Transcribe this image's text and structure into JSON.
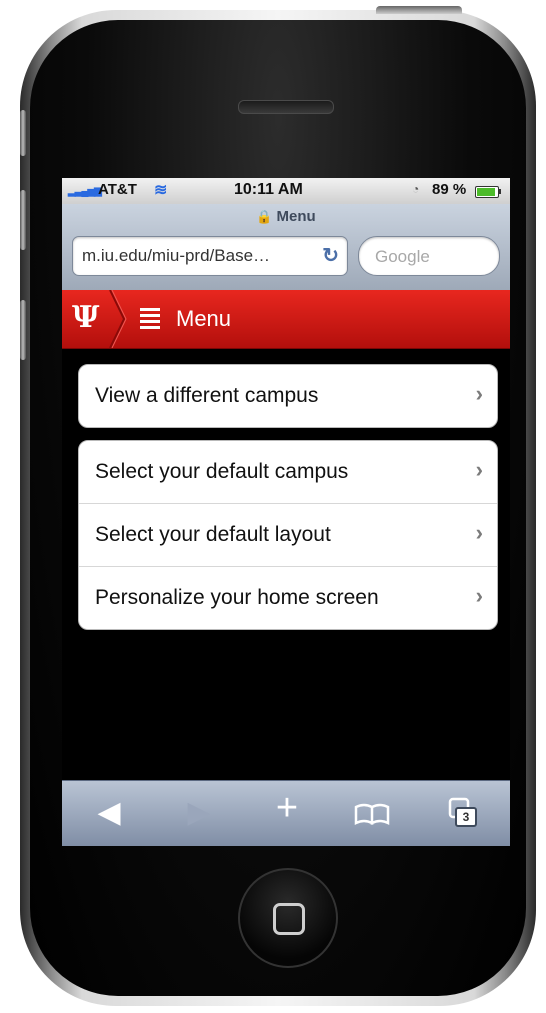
{
  "status_bar": {
    "carrier": "AT&T",
    "time": "10:11 AM",
    "battery_percent": "89 %",
    "battery_level": 0.89
  },
  "browser": {
    "page_title": "Menu",
    "url": "m.iu.edu/miu-prd/Base…",
    "search_placeholder": "Google",
    "tab_count": "3"
  },
  "header": {
    "logo": "Ψ",
    "title": "Menu"
  },
  "menu": {
    "group1": [
      {
        "label": "View a different campus"
      }
    ],
    "group2": [
      {
        "label": "Select your default campus"
      },
      {
        "label": "Select your default layout"
      },
      {
        "label": "Personalize your home screen"
      }
    ]
  },
  "toolbar": {
    "back_icon": "back-arrow-icon",
    "forward_icon": "forward-arrow-icon",
    "add_icon": "plus-icon",
    "bookmarks_icon": "bookmarks-book-icon",
    "tabs_icon": "pages-icon"
  },
  "colors": {
    "iu_red": "#c8102e",
    "ios_toolbar": "#8a98ae"
  }
}
